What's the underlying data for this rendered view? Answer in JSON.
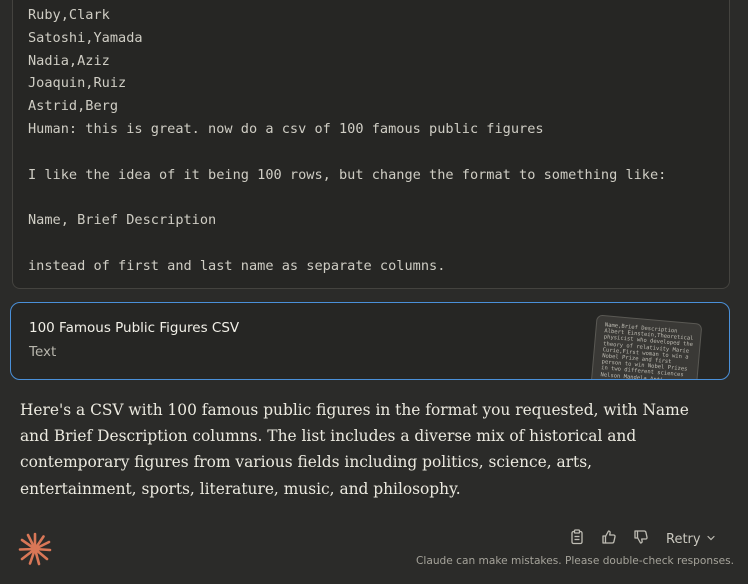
{
  "code_block": {
    "lines": [
      "Ruby,Clark",
      "Satoshi,Yamada",
      "Nadia,Aziz",
      "Joaquin,Ruiz",
      "Astrid,Berg",
      "Human: this is great. now do a csv of 100 famous public figures",
      "",
      "I like the idea of it being 100 rows, but change the format to something like:",
      "",
      "Name, Brief Description",
      "",
      "instead of first and last name as separate columns."
    ]
  },
  "artifact": {
    "title": "100 Famous Public Figures CSV",
    "type": "Text",
    "thumbnail_text": "Name,Brief Description Albert Einstein,Theoretical physicist who developed the theory of relativity Marie Curie,First woman to win a Nobel Prize and first person to win Nobel Prizes in two different sciences Nelson Mandela,Anti-apartheid activist"
  },
  "response": {
    "text": "Here's a CSV with 100 famous public figures in the format you requested, with Name and Brief Description columns. The list includes a diverse mix of historical and contemporary figures from various fields including politics, science, arts, entertainment, sports, literature, music, and philosophy."
  },
  "footer": {
    "retry_label": "Retry",
    "disclaimer": "Claude can make mistakes. Please double-check responses.",
    "icons": [
      "clipboard-icon",
      "thumbs-up-icon",
      "thumbs-down-icon",
      "chevron-down-icon",
      "claude-logo"
    ]
  },
  "colors": {
    "background": "#2b2b29",
    "code_background": "#262624",
    "artifact_border": "#4a90d9",
    "logo": "#d97757"
  }
}
